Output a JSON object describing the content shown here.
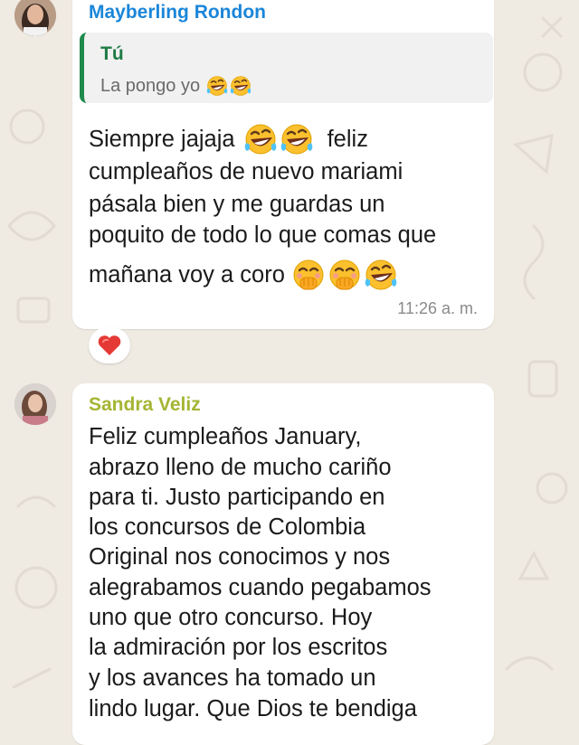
{
  "messages": [
    {
      "sender": "Mayberling Rondon",
      "sender_color": "#1a86d9",
      "reply": {
        "author": "Tú",
        "text": "La pongo yo"
      },
      "lines": [
        "Siempre jajaja",
        "feliz",
        "cumpleaños de nuevo mariami",
        "pásala bien y me guardas un",
        "poquito de todo lo que comas que",
        "mañana voy a coro"
      ],
      "time": "11:26 a. m.",
      "reaction": "red-heart"
    },
    {
      "sender": "Sandra Veliz",
      "sender_color": "#a5b533",
      "lines": [
        "Feliz cumpleaños January,",
        "abrazo lleno de mucho cariño",
        "para ti. Justo participando en",
        "los concursos de Colombia",
        "Original nos conocimos y nos",
        "alegrabamos cuando pegabamos",
        "uno que otro concurso. Hoy",
        "la admiración por los escritos",
        "y los avances ha tomado un",
        "lindo lugar. Que Dios te bendiga"
      ]
    }
  ],
  "icons": {
    "laugh": "rolling-on-floor-laughing-emoji",
    "giggle": "hand-over-mouth-emoji",
    "heart": "red-heart-emoji"
  }
}
